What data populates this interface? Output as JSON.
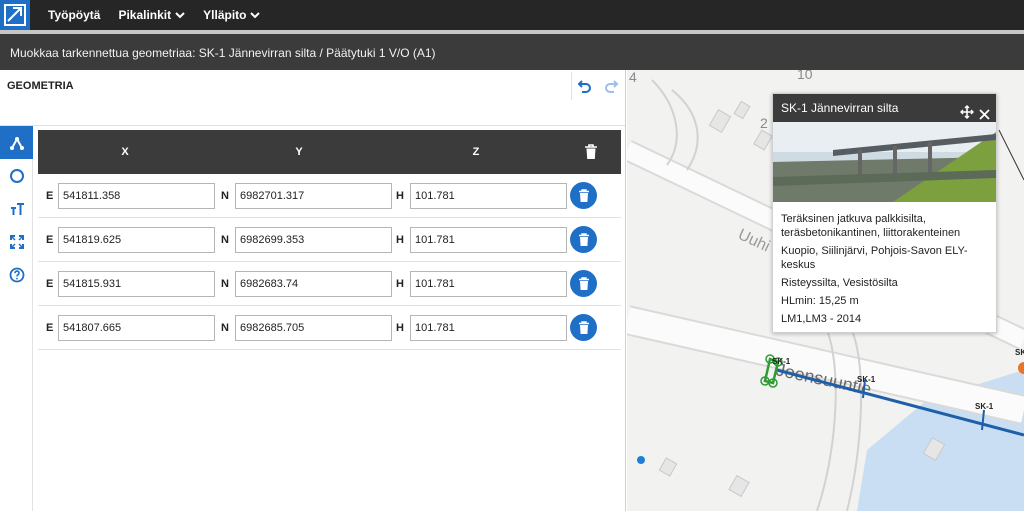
{
  "nav": {
    "items": [
      {
        "label": "Työpöytä",
        "dropdown": false
      },
      {
        "label": "Pikalinkit",
        "dropdown": true
      },
      {
        "label": "Ylläpito",
        "dropdown": true
      }
    ]
  },
  "title": "Muokkaa tarkennettua geometriaa: SK-1 Jännevirran silta / Päätytuki 1 V/O (A1)",
  "panel": {
    "heading": "GEOMETRIA",
    "columns": [
      "X",
      "Y",
      "Z"
    ],
    "row_labels": {
      "e": "E",
      "n": "N",
      "h": "H"
    },
    "rows": [
      {
        "x": "541811.358",
        "y": "6982701.317",
        "z": "101.781"
      },
      {
        "x": "541819.625",
        "y": "6982699.353",
        "z": "101.781"
      },
      {
        "x": "541815.931",
        "y": "6982683.74",
        "z": "101.781"
      },
      {
        "x": "541807.665",
        "y": "6982685.705",
        "z": "101.781"
      }
    ],
    "tools": [
      "vertex-tool-icon",
      "circle-tool-icon",
      "text-size-tool-icon",
      "fit-extent-tool-icon",
      "help-tool-icon"
    ]
  },
  "map": {
    "labels": {
      "n4": "4",
      "n10": "10",
      "n2": "2",
      "road1": "Uuhi",
      "road2": "Joensuuntie",
      "sk_a": "SK-1",
      "sk_b": "SK-1",
      "sk_c": "SK-1",
      "sk_d": "SK"
    }
  },
  "popup": {
    "title": "SK-1 Jännevirran silta",
    "lines": [
      "Teräksinen jatkuva palkkisilta, teräsbetonikantinen, liittorakenteinen",
      "Kuopio, Siilinjärvi, Pohjois-Savon ELY-keskus",
      "Risteyssilta, Vesistösilta",
      "HLmin: 15,25 m",
      "LM1,LM3 - 2014"
    ]
  },
  "colors": {
    "accent": "#1f6fc7",
    "dark": "#262626",
    "header": "#3b3b3b",
    "green": "#2e9c33"
  }
}
